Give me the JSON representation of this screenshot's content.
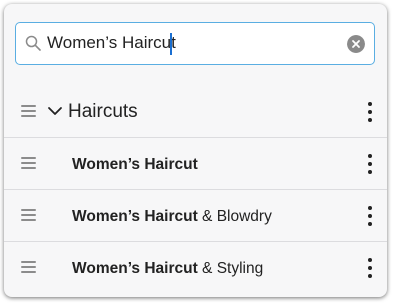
{
  "search": {
    "value": "Women’s Haircut",
    "clear_icon": "clear-circle-icon",
    "search_icon": "magnifier-icon"
  },
  "group": {
    "label": "Haircuts",
    "expanded": true
  },
  "items": [
    {
      "bold": "Women’s Haircut",
      "rest": ""
    },
    {
      "bold": "Women’s Haircut",
      "rest": " & Blowdry"
    },
    {
      "bold": "Women’s Haircut",
      "rest": " & Styling"
    }
  ],
  "colors": {
    "focus_border": "#5aaee2",
    "caret": "#1a6fd1",
    "panel_background": "#f7f7f8"
  }
}
